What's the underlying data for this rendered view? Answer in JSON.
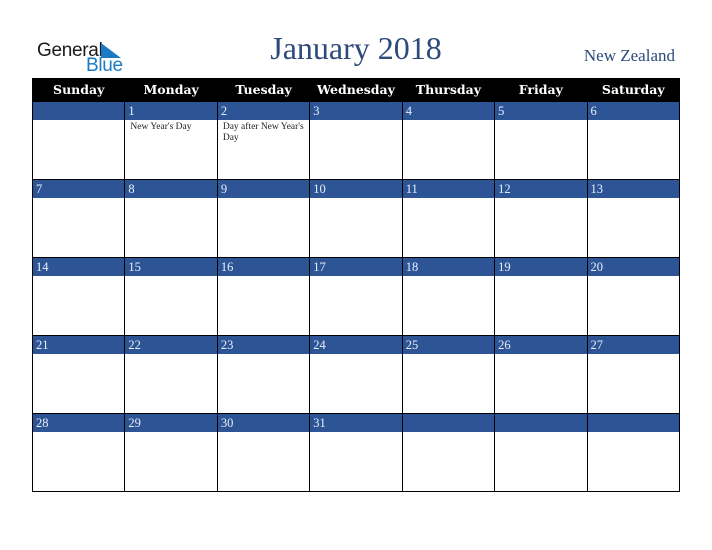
{
  "logo": {
    "line1": "General",
    "line2": "Blue"
  },
  "header": {
    "title": "January 2018",
    "country": "New Zealand"
  },
  "weekdays": [
    "Sunday",
    "Monday",
    "Tuesday",
    "Wednesday",
    "Thursday",
    "Friday",
    "Saturday"
  ],
  "weeks": [
    [
      {
        "day": "",
        "holiday": ""
      },
      {
        "day": "1",
        "holiday": "New Year's Day"
      },
      {
        "day": "2",
        "holiday": "Day after New Year's Day"
      },
      {
        "day": "3",
        "holiday": ""
      },
      {
        "day": "4",
        "holiday": ""
      },
      {
        "day": "5",
        "holiday": ""
      },
      {
        "day": "6",
        "holiday": ""
      }
    ],
    [
      {
        "day": "7",
        "holiday": ""
      },
      {
        "day": "8",
        "holiday": ""
      },
      {
        "day": "9",
        "holiday": ""
      },
      {
        "day": "10",
        "holiday": ""
      },
      {
        "day": "11",
        "holiday": ""
      },
      {
        "day": "12",
        "holiday": ""
      },
      {
        "day": "13",
        "holiday": ""
      }
    ],
    [
      {
        "day": "14",
        "holiday": ""
      },
      {
        "day": "15",
        "holiday": ""
      },
      {
        "day": "16",
        "holiday": ""
      },
      {
        "day": "17",
        "holiday": ""
      },
      {
        "day": "18",
        "holiday": ""
      },
      {
        "day": "19",
        "holiday": ""
      },
      {
        "day": "20",
        "holiday": ""
      }
    ],
    [
      {
        "day": "21",
        "holiday": ""
      },
      {
        "day": "22",
        "holiday": ""
      },
      {
        "day": "23",
        "holiday": ""
      },
      {
        "day": "24",
        "holiday": ""
      },
      {
        "day": "25",
        "holiday": ""
      },
      {
        "day": "26",
        "holiday": ""
      },
      {
        "day": "27",
        "holiday": ""
      }
    ],
    [
      {
        "day": "28",
        "holiday": ""
      },
      {
        "day": "29",
        "holiday": ""
      },
      {
        "day": "30",
        "holiday": ""
      },
      {
        "day": "31",
        "holiday": ""
      },
      {
        "day": "",
        "holiday": ""
      },
      {
        "day": "",
        "holiday": ""
      },
      {
        "day": "",
        "holiday": ""
      }
    ]
  ],
  "colors": {
    "title": "#2c4a7a",
    "day_bar": "#2d5596",
    "header_bg": "#000000",
    "logo_blue": "#1a7bc4"
  }
}
